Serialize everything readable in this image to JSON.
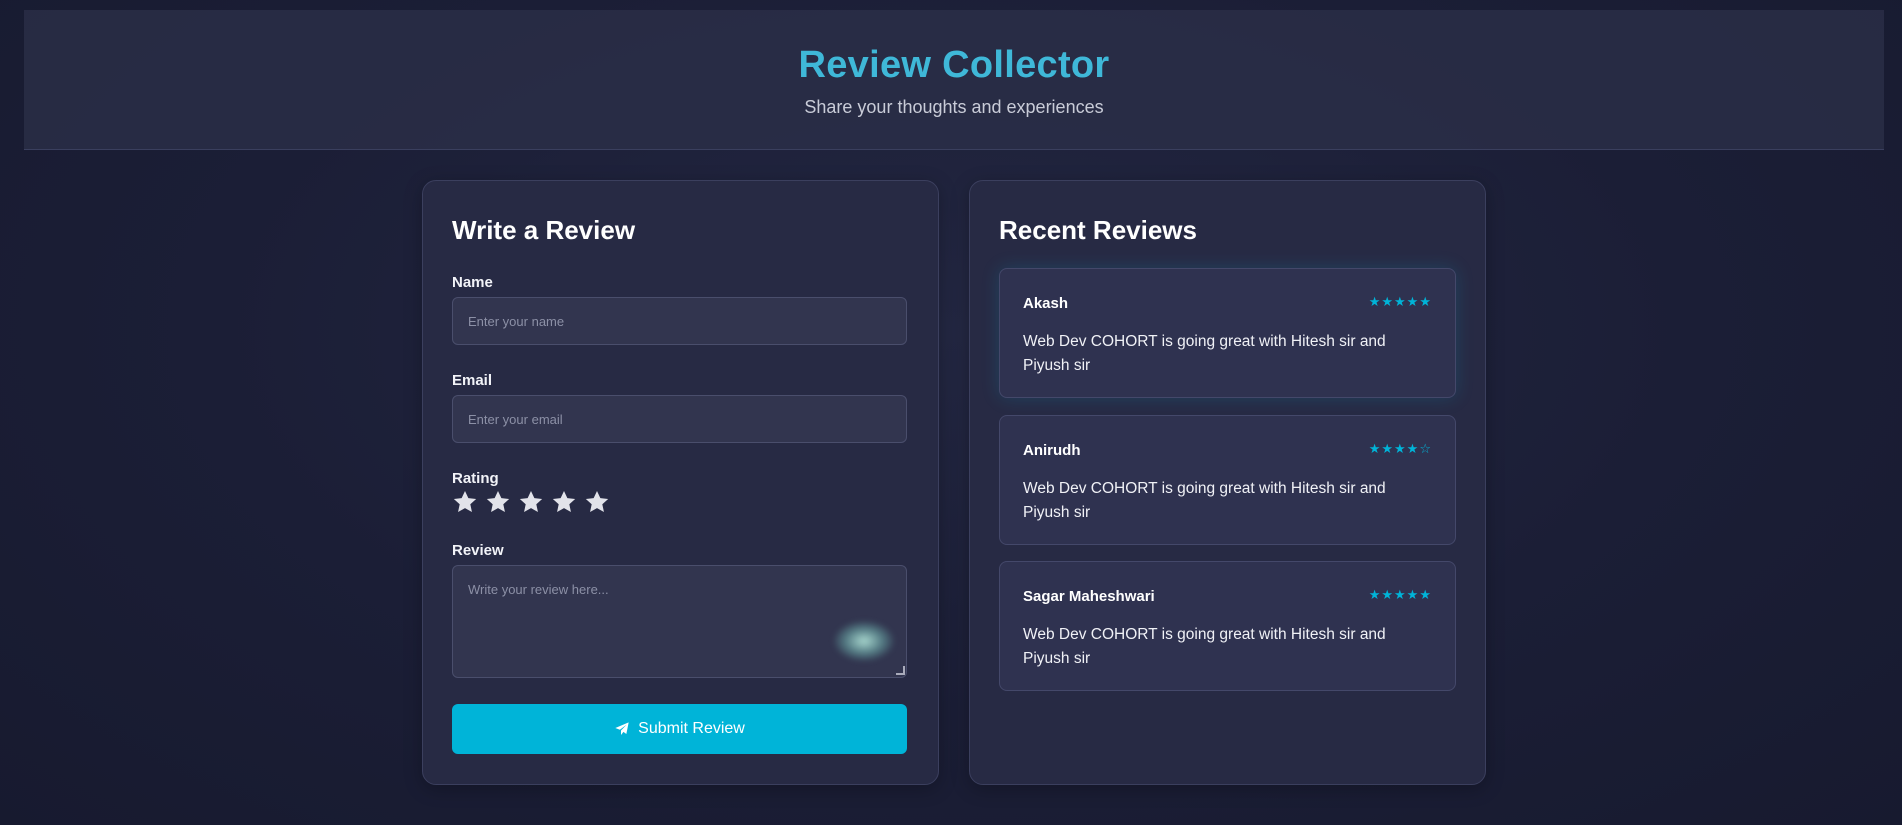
{
  "header": {
    "title": "Review Collector",
    "subtitle": "Share your thoughts and experiences"
  },
  "form": {
    "heading": "Write a Review",
    "name_label": "Name",
    "name_placeholder": "Enter your name",
    "name_value": "",
    "email_label": "Email",
    "email_placeholder": "Enter your email",
    "email_value": "",
    "rating_label": "Rating",
    "rating_value": 0,
    "rating_max": 5,
    "review_label": "Review",
    "review_placeholder": "Write your review here...",
    "review_value": "",
    "submit_label": "Submit Review",
    "submit_icon": "paper-plane-icon"
  },
  "reviews": {
    "heading": "Recent Reviews",
    "items": [
      {
        "name": "Akash",
        "stars": "★★★★★",
        "rating": 5,
        "text": "Web Dev COHORT is going great with Hitesh sir and Piyush sir"
      },
      {
        "name": "Anirudh",
        "stars": "★★★★☆",
        "rating": 4,
        "text": "Web Dev COHORT is going great with Hitesh sir and Piyush sir"
      },
      {
        "name": "Sagar Maheshwari",
        "stars": "★★★★★",
        "rating": 5,
        "text": "Web Dev COHORT is going great with Hitesh sir and Piyush sir"
      }
    ]
  },
  "colors": {
    "accent": "#00b4d8",
    "title": "#3fb8d8",
    "card_bg": "#272a44",
    "page_bg": "#1a1d33",
    "star_empty": "#e2e3ea"
  }
}
